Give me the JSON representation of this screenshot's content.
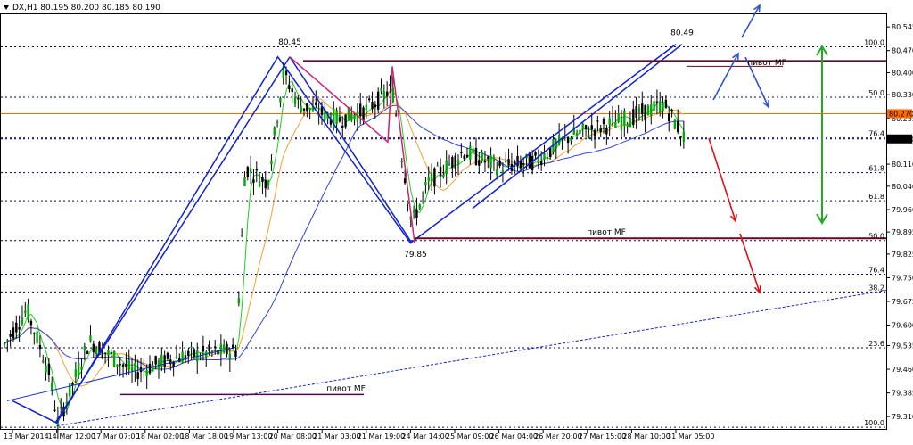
{
  "header": {
    "symbol_icon": "triangle-down-icon",
    "text": "DX,H1  80.195 80.200 80.185 80.190"
  },
  "colors": {
    "background": "#ffffff",
    "grid": "#00006e",
    "candle": "#000000",
    "bull": "#00aa00",
    "ma_green": "#22cc22",
    "ma_orange": "#f0a030",
    "ma_blue": "#3344dd",
    "wave": "#1122cc",
    "pink": "#cc2277",
    "pivot": "#6b0020",
    "price_orange": "#ff6a00",
    "fib": "#a05050",
    "arrow_blue": "#3355cc",
    "arrow_red": "#dd1111",
    "arrow_green": "#22aa22"
  },
  "chart_data": {
    "type": "candlestick",
    "instrument": "DX",
    "timeframe": "H1",
    "ohlc_header": {
      "open": 80.195,
      "high": 80.2,
      "low": 80.185,
      "close": 80.19
    },
    "current_price": 80.19,
    "y_axis": {
      "ylim": [
        79.268,
        80.585
      ],
      "ticks": [
        80.545,
        80.47,
        80.4,
        80.33,
        80.255,
        80.185,
        80.11,
        80.04,
        79.966,
        79.895,
        79.825,
        79.75,
        79.675,
        79.6,
        79.535,
        79.46,
        79.385,
        79.31
      ]
    },
    "x_axis": {
      "tick_labels": [
        "13 Mar 2014",
        "14 Mar 12:00",
        "17 Mar 07:00",
        "18 Mar 02:00",
        "18 Mar 18:00",
        "19 Mar 13:00",
        "20 Mar 08:00",
        "21 Mar 03:00",
        "21 Mar 19:00",
        "24 Mar 14:00",
        "25 Mar 09:00",
        "26 Mar 04:00",
        "26 Mar 20:00",
        "27 Mar 15:00",
        "28 Mar 10:00",
        "31 Mar 05:00"
      ]
    },
    "price_levels": [
      {
        "label": "80.270",
        "value": 80.27,
        "kind": "price_line"
      },
      {
        "label": "80.190",
        "value": 80.19,
        "kind": "current"
      }
    ],
    "fib_levels": [
      {
        "label": "100.0",
        "value": 80.482
      },
      {
        "label": "50.0",
        "value": 80.322
      },
      {
        "label": "76.4",
        "value": 80.193
      },
      {
        "label": "61.8",
        "value": 80.083
      },
      {
        "label": "61.8",
        "value": 79.994
      },
      {
        "label": "50.0",
        "value": 79.868
      },
      {
        "label": "76.4",
        "value": 79.761
      },
      {
        "label": "38.2",
        "value": 79.705
      },
      {
        "label": "23.6",
        "value": 79.528
      },
      {
        "label": "100.0",
        "value": 79.276
      }
    ],
    "annotations": [
      {
        "text": "80.45",
        "x": "20 Mar 08:00",
        "y": 80.45
      },
      {
        "text": "80.49",
        "x": "31 Mar 05:00",
        "y": 80.49
      },
      {
        "text": "79.85",
        "x": "24 Mar 14:00",
        "y": 79.85
      },
      {
        "text": "пивот MF",
        "kind": "pivot_label",
        "level": 80.43
      },
      {
        "text": "пивот MF",
        "kind": "pivot_label",
        "level": 79.875
      },
      {
        "text": "пивот MF",
        "kind": "pivot_label",
        "level": 79.38
      }
    ],
    "pivot_lines": [
      80.437,
      80.42,
      79.875,
      79.875,
      79.38
    ],
    "wave_points": [
      {
        "x": "13 Mar 2014",
        "y": 79.36
      },
      {
        "x": "14 Mar 12:00",
        "y": 79.29
      },
      {
        "x": "20 Mar 08:00",
        "y": 80.45
      },
      {
        "x": "24 Mar 14:00",
        "y": 79.86
      },
      {
        "x": "31 Mar 05:00",
        "y": 80.49
      }
    ],
    "trendline": [
      {
        "x": "14 Mar 12:00",
        "y": 79.28
      },
      {
        "x": "right edge",
        "y": 79.71
      }
    ],
    "candle_seed": [
      [
        79.6,
        79.62
      ],
      [
        79.5,
        79.55
      ],
      [
        79.35,
        79.42
      ],
      [
        79.45,
        79.5
      ],
      [
        79.55,
        79.63
      ],
      [
        79.5,
        79.45
      ],
      [
        79.45,
        79.5
      ],
      [
        79.48,
        79.47
      ],
      [
        79.48,
        79.5
      ],
      [
        79.55,
        79.52
      ],
      [
        80.05,
        80.15
      ],
      [
        80.35,
        80.42
      ],
      [
        80.33,
        80.3
      ],
      [
        80.25,
        80.28
      ],
      [
        80.2,
        80.15
      ],
      [
        80.35,
        80.38
      ],
      [
        79.9,
        80.1
      ],
      [
        80.1,
        80.12
      ],
      [
        80.15,
        80.18
      ],
      [
        80.2,
        80.22
      ],
      [
        80.22,
        80.26
      ],
      [
        80.25,
        80.28
      ],
      [
        80.28,
        80.3
      ],
      [
        80.27,
        80.31
      ],
      [
        80.15,
        80.19
      ]
    ],
    "grid": true
  }
}
